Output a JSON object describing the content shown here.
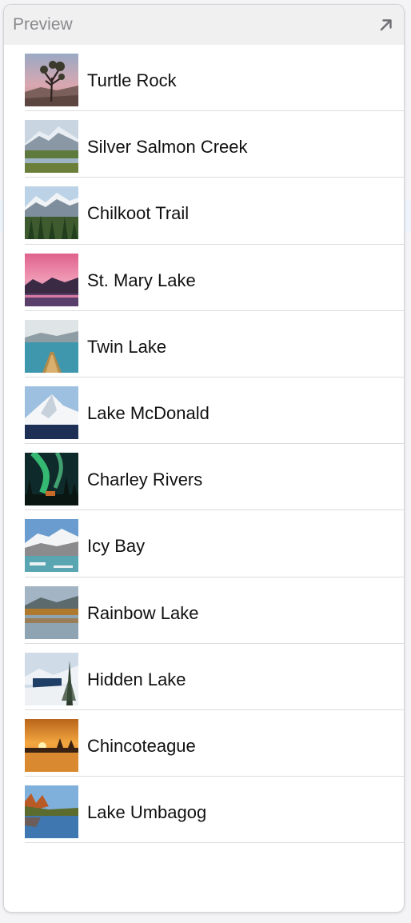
{
  "panel": {
    "title": "Preview",
    "expand_icon": "arrow-up-right-icon"
  },
  "landmarks": [
    {
      "name": "Turtle Rock",
      "thumbnail": "turtle-rock-thumbnail"
    },
    {
      "name": "Silver Salmon Creek",
      "thumbnail": "silver-salmon-creek-thumbnail"
    },
    {
      "name": "Chilkoot Trail",
      "thumbnail": "chilkoot-trail-thumbnail"
    },
    {
      "name": "St. Mary Lake",
      "thumbnail": "st-mary-lake-thumbnail"
    },
    {
      "name": "Twin Lake",
      "thumbnail": "twin-lake-thumbnail"
    },
    {
      "name": "Lake McDonald",
      "thumbnail": "lake-mcdonald-thumbnail"
    },
    {
      "name": "Charley Rivers",
      "thumbnail": "charley-rivers-thumbnail"
    },
    {
      "name": "Icy Bay",
      "thumbnail": "icy-bay-thumbnail"
    },
    {
      "name": "Rainbow Lake",
      "thumbnail": "rainbow-lake-thumbnail"
    },
    {
      "name": "Hidden Lake",
      "thumbnail": "hidden-lake-thumbnail"
    },
    {
      "name": "Chincoteague",
      "thumbnail": "chincoteague-thumbnail"
    },
    {
      "name": "Lake Umbagog",
      "thumbnail": "lake-umbagog-thumbnail"
    }
  ]
}
